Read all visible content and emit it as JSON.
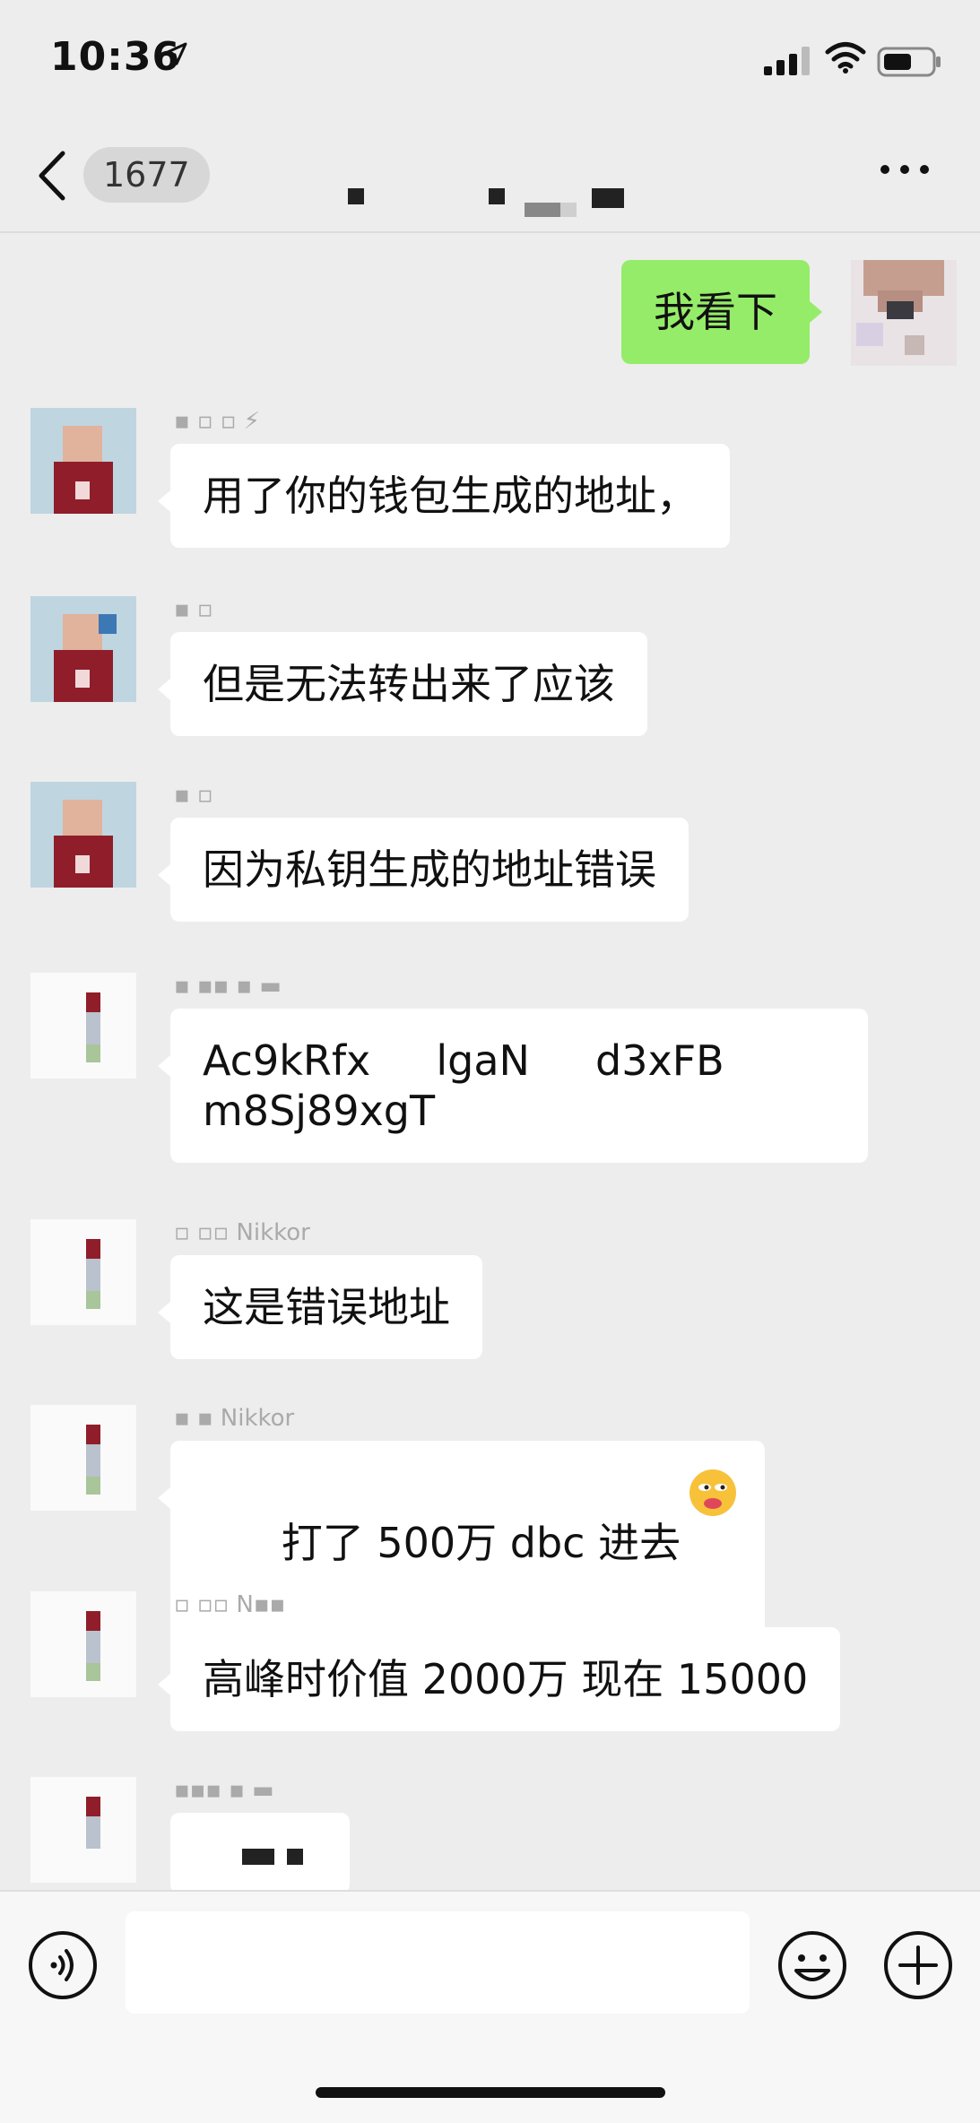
{
  "status_bar": {
    "time": "10:36"
  },
  "header": {
    "unread_count": "1677"
  },
  "messages": [
    {
      "text": "我看下",
      "mine": true
    },
    {
      "text": "用了你的钱包生成的地址，",
      "mine": false
    },
    {
      "text": "但是无法转出来了应该",
      "mine": false
    },
    {
      "text": "因为私钥生成的地址错误",
      "mine": false
    },
    {
      "text": "Ac9kRfx\u0002     \u0002lgaN     d3xFB \nm8Sj89xgT",
      "mine": false
    },
    {
      "text": "这是错误地址",
      "mine": false
    },
    {
      "text": "打了 500万 dbc 进去",
      "mine": false
    },
    {
      "text": "高峰时价值 2000万 现在 15000",
      "mine": false
    }
  ],
  "colors": {
    "my_bubble": "#95ec69",
    "other_bubble": "#ffffff",
    "background": "#ededed"
  }
}
